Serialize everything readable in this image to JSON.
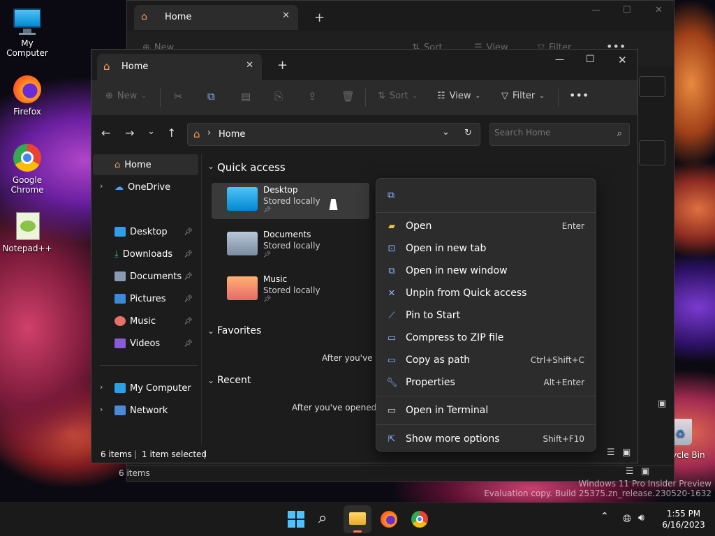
{
  "desktop": {
    "icons": [
      {
        "label": "My Computer",
        "icon": "monitor-icon"
      },
      {
        "label": "Firefox",
        "icon": "firefox-icon"
      },
      {
        "label": "Google Chrome",
        "icon": "chrome-icon"
      },
      {
        "label": "Notepad++",
        "icon": "notepad-plus-plus-icon"
      },
      {
        "label": "Recycle Bin",
        "icon": "recycle-bin-icon"
      }
    ],
    "watermark_line1": "Windows 11 Pro Insider Preview",
    "watermark_line2": "Evaluation copy. Build 25375.zn_release.230520-1632"
  },
  "back_window": {
    "tab_title": "Home",
    "new_label": "New",
    "sort_label": "Sort",
    "view_label": "View",
    "filter_label": "Filter",
    "status_items": "6 items"
  },
  "explorer": {
    "tab_title": "Home",
    "toolbar": {
      "new": "New",
      "sort": "Sort",
      "view": "View",
      "filter": "Filter"
    },
    "breadcrumb": "Home",
    "search_placeholder": "Search Home",
    "nav": {
      "home": "Home",
      "onedrive": "OneDrive",
      "pinned": [
        "Desktop",
        "Downloads",
        "Documents",
        "Pictures",
        "Music",
        "Videos"
      ],
      "my_computer": "My Computer",
      "network": "Network"
    },
    "sections": {
      "quick_access": "Quick access",
      "favorites": "Favorites",
      "recent": "Recent"
    },
    "quick_items": [
      {
        "name": "Desktop",
        "sub": "Stored locally"
      },
      {
        "name": "Documents",
        "sub": "Stored locally"
      },
      {
        "name": "Music",
        "sub": "Stored locally"
      }
    ],
    "favorites_empty": "After you've pi",
    "recent_empty": "After you've opened sc",
    "status": {
      "items": "6 items",
      "selected": "1 item selected"
    }
  },
  "context_menu": {
    "items": [
      {
        "label": "Open",
        "shortcut": "Enter",
        "icon": "folder-open-icon"
      },
      {
        "label": "Open in new tab",
        "shortcut": "",
        "icon": "new-tab-icon"
      },
      {
        "label": "Open in new window",
        "shortcut": "",
        "icon": "new-window-icon"
      },
      {
        "label": "Unpin from Quick access",
        "shortcut": "",
        "icon": "unpin-icon"
      },
      {
        "label": "Pin to Start",
        "shortcut": "",
        "icon": "pin-icon"
      },
      {
        "label": "Compress to ZIP file",
        "shortcut": "",
        "icon": "zip-icon"
      },
      {
        "label": "Copy as path",
        "shortcut": "Ctrl+Shift+C",
        "icon": "copy-path-icon"
      },
      {
        "label": "Properties",
        "shortcut": "Alt+Enter",
        "icon": "wrench-icon"
      },
      {
        "label": "Open in Terminal",
        "shortcut": "",
        "icon": "terminal-icon"
      },
      {
        "label": "Show more options",
        "shortcut": "Shift+F10",
        "icon": "more-options-icon"
      }
    ]
  },
  "taskbar": {
    "time": "1:55 PM",
    "date": "6/16/2023"
  }
}
